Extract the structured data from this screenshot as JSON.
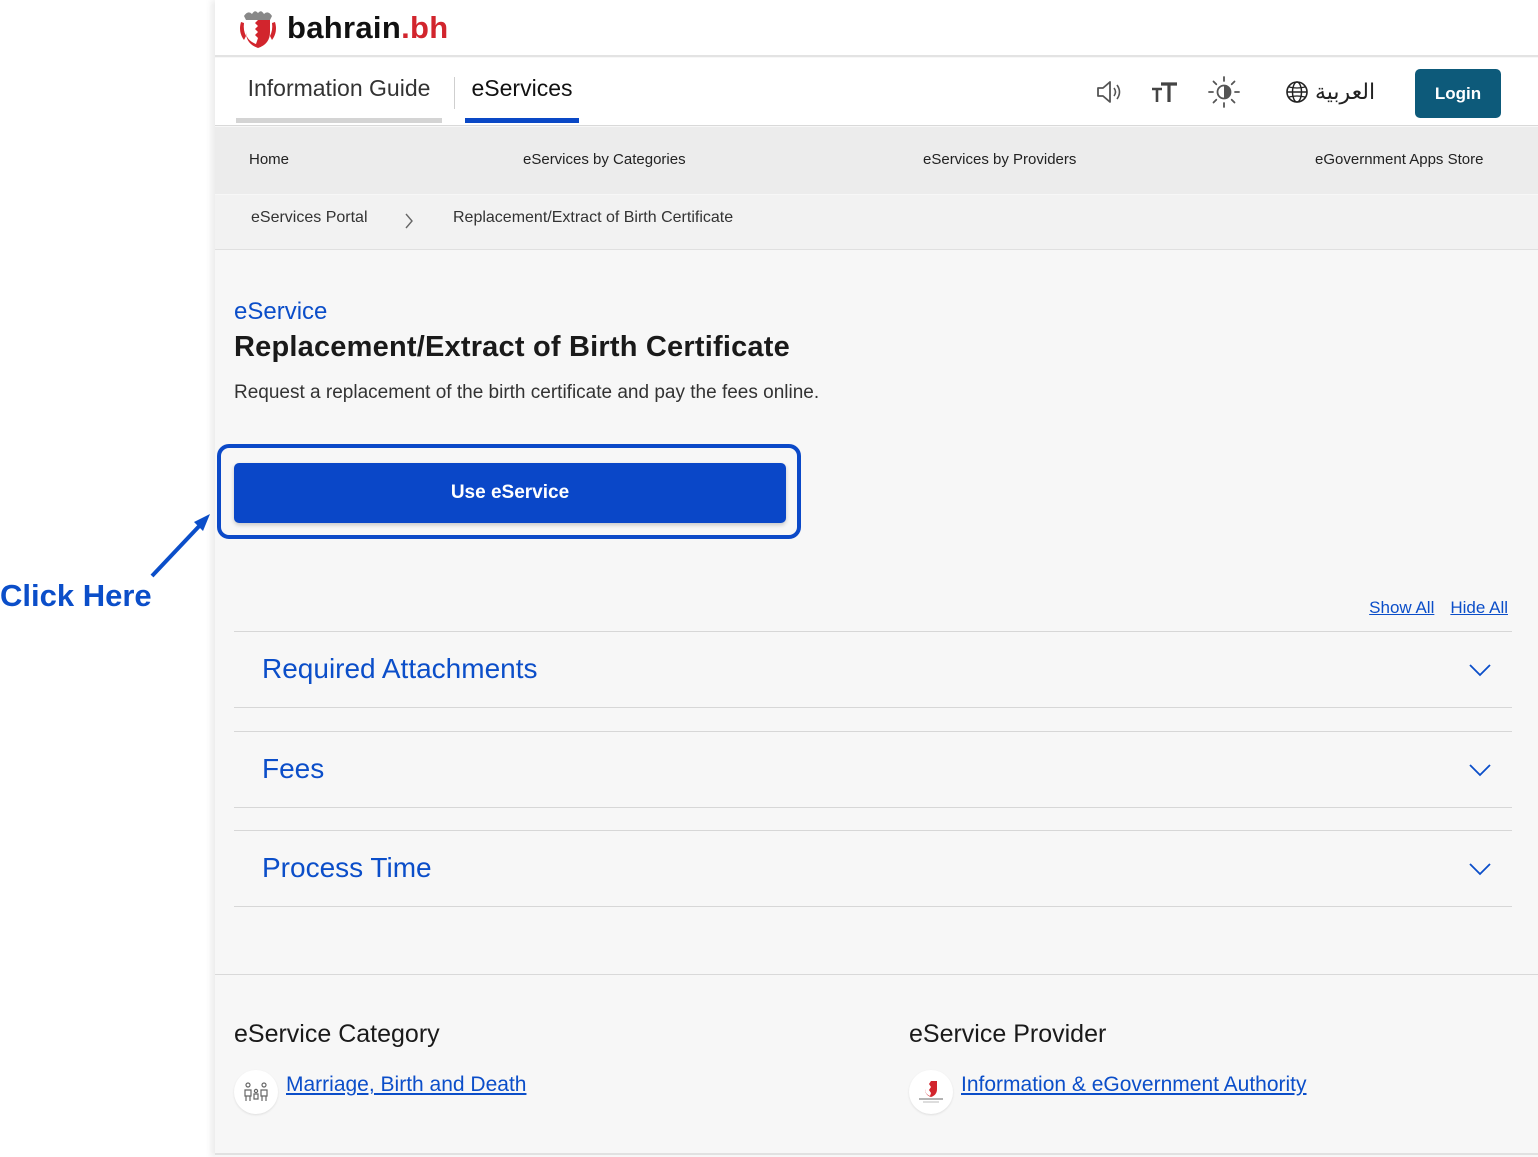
{
  "annotation": {
    "callout_text": "Click Here",
    "accent_color": "#0b4ec9"
  },
  "header": {
    "logo_text_main": "bahrain",
    "logo_text_suffix": ".bh"
  },
  "topnav": {
    "tabs": [
      {
        "label": "Information Guide",
        "active": false
      },
      {
        "label": "eServices",
        "active": true
      }
    ],
    "tools": [
      {
        "icon": "speaker-icon"
      },
      {
        "icon": "text-size-icon"
      },
      {
        "icon": "brightness-icon"
      }
    ],
    "language_label": "العربية",
    "login_label": "Login"
  },
  "subnav": {
    "items": [
      "Home",
      "eServices by Categories",
      "eServices by Providers",
      "eGovernment Apps Store"
    ]
  },
  "breadcrumb": {
    "items": [
      "eServices Portal",
      "Replacement/Extract of Birth Certificate"
    ]
  },
  "service": {
    "kicker": "eService",
    "title": "Replacement/Extract of Birth Certificate",
    "description": "Request a replacement of the birth certificate and pay the fees online.",
    "cta_label": "Use eService"
  },
  "accordion": {
    "show_all": "Show All",
    "hide_all": "Hide All",
    "sections": [
      {
        "label": "Required Attachments",
        "expanded": false
      },
      {
        "label": "Fees",
        "expanded": false
      },
      {
        "label": "Process Time",
        "expanded": false
      }
    ]
  },
  "footer": {
    "category_heading": "eService Category",
    "category_link": "Marriage, Birth and Death",
    "provider_heading": "eService Provider",
    "provider_link": "Information & eGovernment Authority"
  },
  "colors": {
    "primary_blue": "#0a47c8",
    "login_teal": "#0d5a7a",
    "brand_red": "#d2252d"
  }
}
